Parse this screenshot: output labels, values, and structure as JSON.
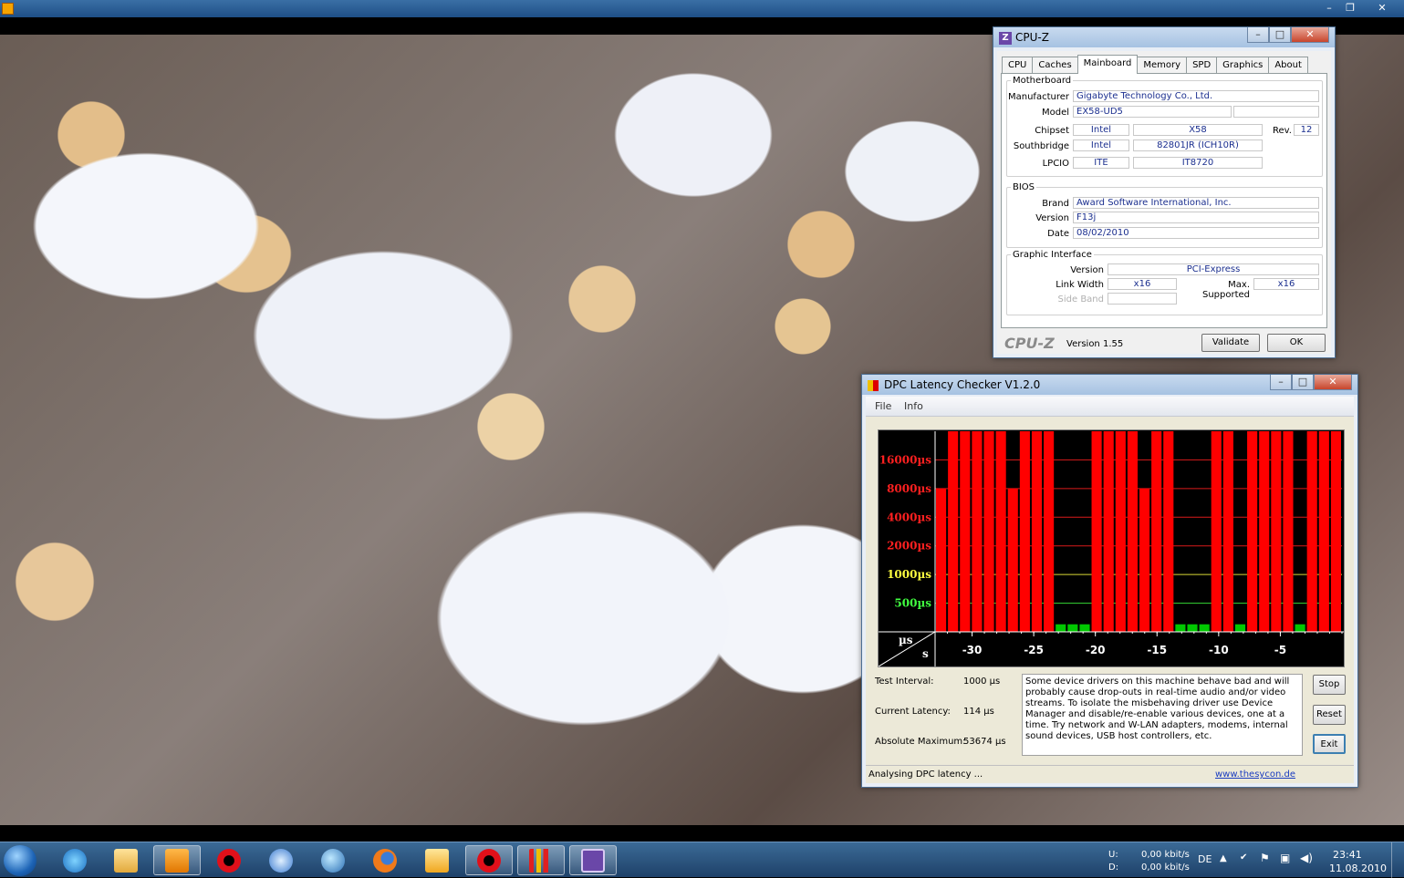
{
  "player": {
    "window_controls": [
      "–",
      "❐",
      "✕"
    ]
  },
  "cpuz": {
    "title": "CPU-Z",
    "tabs": [
      "CPU",
      "Caches",
      "Mainboard",
      "Memory",
      "SPD",
      "Graphics",
      "About"
    ],
    "selected_tab": "Mainboard",
    "motherboard": {
      "legend": "Motherboard",
      "manufacturer_label": "Manufacturer",
      "manufacturer": "Gigabyte Technology Co., Ltd.",
      "model_label": "Model",
      "model": "EX58-UD5",
      "chipset_label": "Chipset",
      "chipset_vendor": "Intel",
      "chipset": "X58",
      "rev_label": "Rev.",
      "rev": "12",
      "southbridge_label": "Southbridge",
      "southbridge_vendor": "Intel",
      "southbridge": "82801JR (ICH10R)",
      "lpcio_label": "LPCIO",
      "lpcio_vendor": "ITE",
      "lpcio": "IT8720"
    },
    "bios": {
      "legend": "BIOS",
      "brand_label": "Brand",
      "brand": "Award Software International, Inc.",
      "version_label": "Version",
      "version": "F13j",
      "date_label": "Date",
      "date": "08/02/2010"
    },
    "graphic_interface": {
      "legend": "Graphic Interface",
      "version_label": "Version",
      "version": "PCI-Express",
      "link_width_label": "Link Width",
      "link_width": "x16",
      "max_supported_label": "Max. Supported",
      "max_supported": "x16",
      "side_band_label": "Side Band"
    },
    "footer": {
      "logo": "CPU-Z",
      "version": "Version 1.55",
      "validate_label": "Validate",
      "ok_label": "OK"
    }
  },
  "dpc": {
    "title": "DPC Latency Checker V1.2.0",
    "menu": [
      "File",
      "Info"
    ],
    "test_interval_label": "Test Interval:",
    "test_interval": "1000 µs",
    "current_latency_label": "Current Latency:",
    "current_latency": "114 µs",
    "absolute_maximum_label": "Absolute Maximum:",
    "absolute_maximum": "53674 µs",
    "message": "Some device drivers on this machine behave bad and will probably cause drop-outs in real-time audio and/or video streams. To isolate the misbehaving driver use Device Manager and disable/re-enable various devices, one at a time. Try network and W-LAN adapters, modems, internal sound devices, USB host controllers, etc.",
    "stop_label": "Stop",
    "reset_label": "Reset",
    "exit_label": "Exit",
    "status": "Analysing DPC latency ...",
    "link": "www.thesycon.de"
  },
  "chart_data": {
    "type": "bar",
    "y_scale": "log",
    "y_ticks": [
      {
        "label": "16000µs",
        "value": 16000,
        "color": "#ff2020"
      },
      {
        "label": "8000µs",
        "value": 8000,
        "color": "#ff2020"
      },
      {
        "label": "4000µs",
        "value": 4000,
        "color": "#ff2020"
      },
      {
        "label": "2000µs",
        "value": 2000,
        "color": "#ff2020"
      },
      {
        "label": "1000µs",
        "value": 1000,
        "color": "#ffff40"
      },
      {
        "label": "500µs",
        "value": 500,
        "color": "#40ff40"
      }
    ],
    "x_unit_label": "µs",
    "x_axis_label": "s",
    "x_ticks": [
      -30,
      -25,
      -20,
      -15,
      -10,
      -5
    ],
    "x_range": [
      -33,
      0
    ],
    "ylim": [
      250,
      32000
    ],
    "values": [
      8000,
      32000,
      32000,
      32000,
      32000,
      32000,
      8000,
      32000,
      32000,
      32000,
      300,
      300,
      300,
      32000,
      32000,
      32000,
      32000,
      8000,
      32000,
      32000,
      300,
      300,
      300,
      32000,
      32000,
      300,
      32000,
      32000,
      32000,
      32000,
      300,
      32000,
      32000,
      32000
    ]
  },
  "tray": {
    "upload_label": "U:",
    "download_label": "D:",
    "upload_rate": "0,00 kbit/s",
    "download_rate": "0,00 kbit/s",
    "language": "DE",
    "time": "23:41",
    "date": "11.08.2010"
  }
}
